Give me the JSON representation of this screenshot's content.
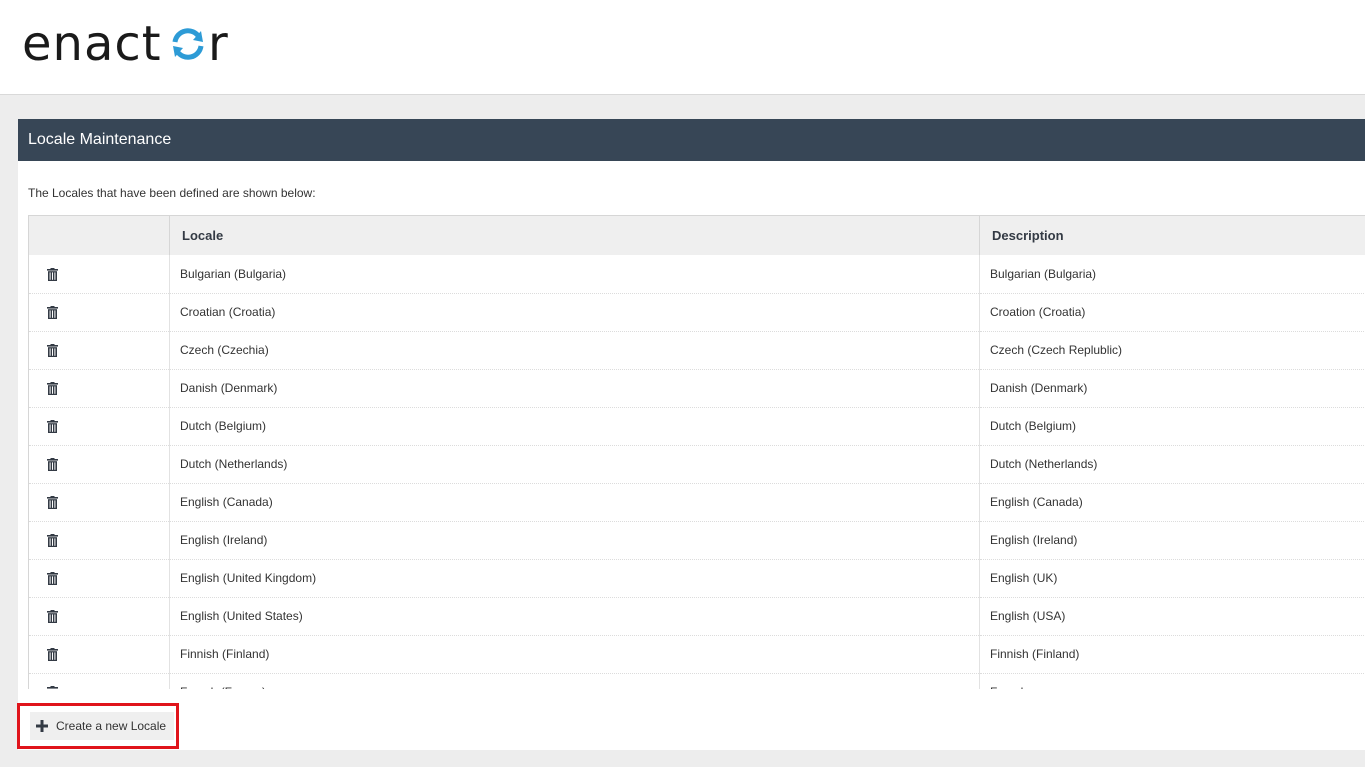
{
  "app": {
    "logo_text": "enactor"
  },
  "panel": {
    "title": "Locale Maintenance",
    "intro": "The Locales that have been defined are shown below:"
  },
  "table": {
    "columns": [
      "",
      "Locale",
      "Description"
    ],
    "rows": [
      {
        "locale": "Bulgarian (Bulgaria)",
        "description": "Bulgarian (Bulgaria)"
      },
      {
        "locale": "Croatian (Croatia)",
        "description": "Croation (Croatia)"
      },
      {
        "locale": "Czech (Czechia)",
        "description": "Czech (Czech Replublic)"
      },
      {
        "locale": "Danish (Denmark)",
        "description": "Danish (Denmark)"
      },
      {
        "locale": "Dutch (Belgium)",
        "description": "Dutch (Belgium)"
      },
      {
        "locale": "Dutch (Netherlands)",
        "description": "Dutch (Netherlands)"
      },
      {
        "locale": "English (Canada)",
        "description": "English (Canada)"
      },
      {
        "locale": "English (Ireland)",
        "description": "English (Ireland)"
      },
      {
        "locale": "English (United Kingdom)",
        "description": "English (UK)"
      },
      {
        "locale": "English (United States)",
        "description": "English (USA)"
      },
      {
        "locale": "Finnish (Finland)",
        "description": "Finnish (Finland)"
      },
      {
        "locale": "French (France)",
        "description": "French"
      }
    ]
  },
  "actions": {
    "create_label": "Create a new Locale"
  },
  "icons": {
    "row_action": "trash-icon",
    "create": "plus-icon"
  },
  "colors": {
    "title_bar": "#374656",
    "logo_dark": "#1a1a1a",
    "logo_accent": "#2d9bd6",
    "highlight": "#e0141b"
  }
}
